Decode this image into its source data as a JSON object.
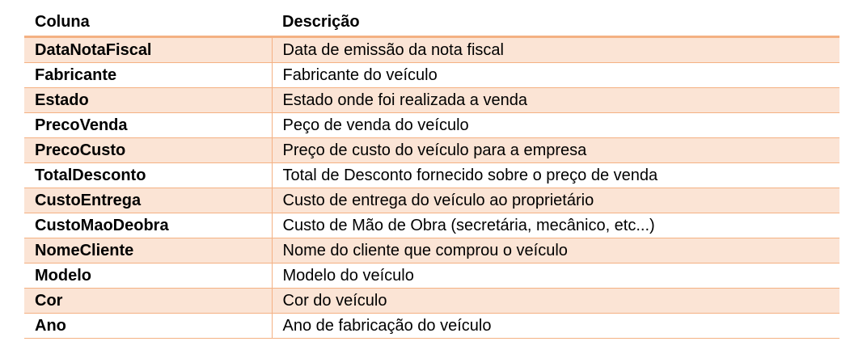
{
  "table": {
    "headers": [
      "Coluna",
      "Descrição"
    ],
    "rows": [
      {
        "coluna": "DataNotaFiscal",
        "descricao": "Data de emissão da nota fiscal"
      },
      {
        "coluna": "Fabricante",
        "descricao": "Fabricante do veículo"
      },
      {
        "coluna": "Estado",
        "descricao": "Estado onde foi realizada a venda"
      },
      {
        "coluna": "PrecoVenda",
        "descricao": "Peço de venda do veículo"
      },
      {
        "coluna": "PrecoCusto",
        "descricao": "Preço de custo do veículo para a empresa"
      },
      {
        "coluna": "TotalDesconto",
        "descricao": "Total de Desconto fornecido sobre o preço de venda"
      },
      {
        "coluna": "CustoEntrega",
        "descricao": "Custo de entrega do veículo ao proprietário"
      },
      {
        "coluna": "CustoMaoDeobra",
        "descricao": "Custo de Mão de Obra (secretária, mecânico, etc...)"
      },
      {
        "coluna": "NomeCliente",
        "descricao": "Nome do cliente que comprou o veículo"
      },
      {
        "coluna": "Modelo",
        "descricao": "Modelo do veículo"
      },
      {
        "coluna": "Cor",
        "descricao": "Cor do veículo"
      },
      {
        "coluna": "Ano",
        "descricao": "Ano de fabricação do veículo"
      }
    ]
  },
  "colors": {
    "band": "#fbe4d5",
    "border": "#f4b183"
  }
}
